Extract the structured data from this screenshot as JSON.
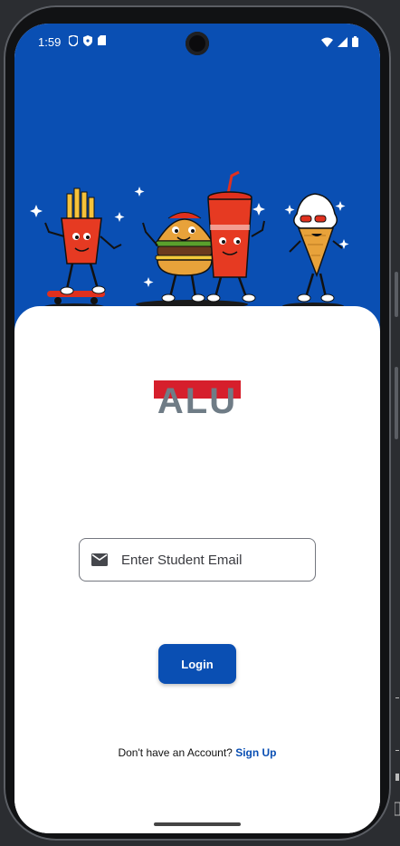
{
  "status_bar": {
    "time": "1:59"
  },
  "brand": {
    "logo_text": "ALU"
  },
  "login_form": {
    "email_placeholder": "Enter Student Email",
    "email_value": "",
    "login_label": "Login"
  },
  "signup": {
    "prompt": "Don't have an Account? ",
    "link_label": "Sign Up"
  },
  "colors": {
    "primary": "#0a4fb3",
    "logo_red": "#d61f2c",
    "logo_gray": "#6f7c86"
  },
  "icons": {
    "email": "email-icon",
    "wifi": "wifi-icon",
    "signal": "signal-icon",
    "battery": "battery-icon"
  }
}
